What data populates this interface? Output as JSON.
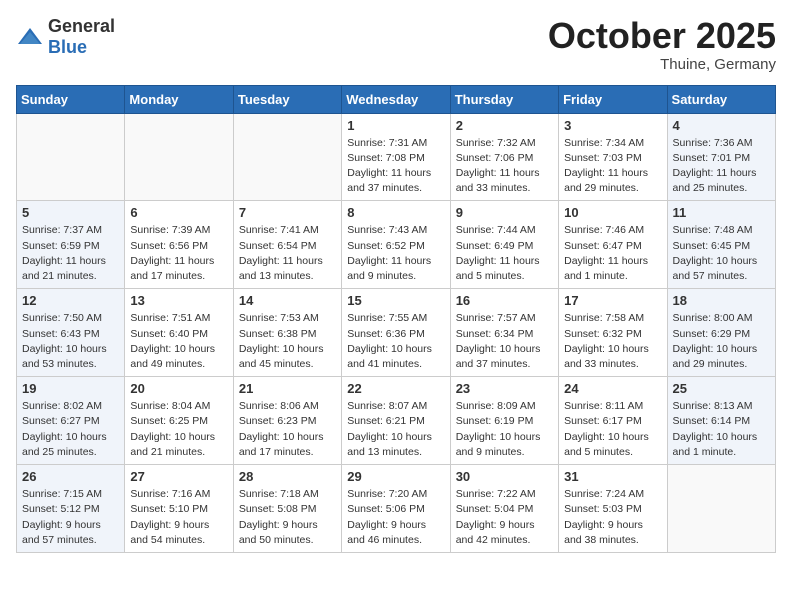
{
  "header": {
    "logo_general": "General",
    "logo_blue": "Blue",
    "month": "October 2025",
    "location": "Thuine, Germany"
  },
  "weekdays": [
    "Sunday",
    "Monday",
    "Tuesday",
    "Wednesday",
    "Thursday",
    "Friday",
    "Saturday"
  ],
  "weeks": [
    [
      {
        "day": "",
        "info": ""
      },
      {
        "day": "",
        "info": ""
      },
      {
        "day": "",
        "info": ""
      },
      {
        "day": "1",
        "info": "Sunrise: 7:31 AM\nSunset: 7:08 PM\nDaylight: 11 hours\nand 37 minutes."
      },
      {
        "day": "2",
        "info": "Sunrise: 7:32 AM\nSunset: 7:06 PM\nDaylight: 11 hours\nand 33 minutes."
      },
      {
        "day": "3",
        "info": "Sunrise: 7:34 AM\nSunset: 7:03 PM\nDaylight: 11 hours\nand 29 minutes."
      },
      {
        "day": "4",
        "info": "Sunrise: 7:36 AM\nSunset: 7:01 PM\nDaylight: 11 hours\nand 25 minutes."
      }
    ],
    [
      {
        "day": "5",
        "info": "Sunrise: 7:37 AM\nSunset: 6:59 PM\nDaylight: 11 hours\nand 21 minutes."
      },
      {
        "day": "6",
        "info": "Sunrise: 7:39 AM\nSunset: 6:56 PM\nDaylight: 11 hours\nand 17 minutes."
      },
      {
        "day": "7",
        "info": "Sunrise: 7:41 AM\nSunset: 6:54 PM\nDaylight: 11 hours\nand 13 minutes."
      },
      {
        "day": "8",
        "info": "Sunrise: 7:43 AM\nSunset: 6:52 PM\nDaylight: 11 hours\nand 9 minutes."
      },
      {
        "day": "9",
        "info": "Sunrise: 7:44 AM\nSunset: 6:49 PM\nDaylight: 11 hours\nand 5 minutes."
      },
      {
        "day": "10",
        "info": "Sunrise: 7:46 AM\nSunset: 6:47 PM\nDaylight: 11 hours\nand 1 minute."
      },
      {
        "day": "11",
        "info": "Sunrise: 7:48 AM\nSunset: 6:45 PM\nDaylight: 10 hours\nand 57 minutes."
      }
    ],
    [
      {
        "day": "12",
        "info": "Sunrise: 7:50 AM\nSunset: 6:43 PM\nDaylight: 10 hours\nand 53 minutes."
      },
      {
        "day": "13",
        "info": "Sunrise: 7:51 AM\nSunset: 6:40 PM\nDaylight: 10 hours\nand 49 minutes."
      },
      {
        "day": "14",
        "info": "Sunrise: 7:53 AM\nSunset: 6:38 PM\nDaylight: 10 hours\nand 45 minutes."
      },
      {
        "day": "15",
        "info": "Sunrise: 7:55 AM\nSunset: 6:36 PM\nDaylight: 10 hours\nand 41 minutes."
      },
      {
        "day": "16",
        "info": "Sunrise: 7:57 AM\nSunset: 6:34 PM\nDaylight: 10 hours\nand 37 minutes."
      },
      {
        "day": "17",
        "info": "Sunrise: 7:58 AM\nSunset: 6:32 PM\nDaylight: 10 hours\nand 33 minutes."
      },
      {
        "day": "18",
        "info": "Sunrise: 8:00 AM\nSunset: 6:29 PM\nDaylight: 10 hours\nand 29 minutes."
      }
    ],
    [
      {
        "day": "19",
        "info": "Sunrise: 8:02 AM\nSunset: 6:27 PM\nDaylight: 10 hours\nand 25 minutes."
      },
      {
        "day": "20",
        "info": "Sunrise: 8:04 AM\nSunset: 6:25 PM\nDaylight: 10 hours\nand 21 minutes."
      },
      {
        "day": "21",
        "info": "Sunrise: 8:06 AM\nSunset: 6:23 PM\nDaylight: 10 hours\nand 17 minutes."
      },
      {
        "day": "22",
        "info": "Sunrise: 8:07 AM\nSunset: 6:21 PM\nDaylight: 10 hours\nand 13 minutes."
      },
      {
        "day": "23",
        "info": "Sunrise: 8:09 AM\nSunset: 6:19 PM\nDaylight: 10 hours\nand 9 minutes."
      },
      {
        "day": "24",
        "info": "Sunrise: 8:11 AM\nSunset: 6:17 PM\nDaylight: 10 hours\nand 5 minutes."
      },
      {
        "day": "25",
        "info": "Sunrise: 8:13 AM\nSunset: 6:14 PM\nDaylight: 10 hours\nand 1 minute."
      }
    ],
    [
      {
        "day": "26",
        "info": "Sunrise: 7:15 AM\nSunset: 5:12 PM\nDaylight: 9 hours\nand 57 minutes."
      },
      {
        "day": "27",
        "info": "Sunrise: 7:16 AM\nSunset: 5:10 PM\nDaylight: 9 hours\nand 54 minutes."
      },
      {
        "day": "28",
        "info": "Sunrise: 7:18 AM\nSunset: 5:08 PM\nDaylight: 9 hours\nand 50 minutes."
      },
      {
        "day": "29",
        "info": "Sunrise: 7:20 AM\nSunset: 5:06 PM\nDaylight: 9 hours\nand 46 minutes."
      },
      {
        "day": "30",
        "info": "Sunrise: 7:22 AM\nSunset: 5:04 PM\nDaylight: 9 hours\nand 42 minutes."
      },
      {
        "day": "31",
        "info": "Sunrise: 7:24 AM\nSunset: 5:03 PM\nDaylight: 9 hours\nand 38 minutes."
      },
      {
        "day": "",
        "info": ""
      }
    ]
  ]
}
